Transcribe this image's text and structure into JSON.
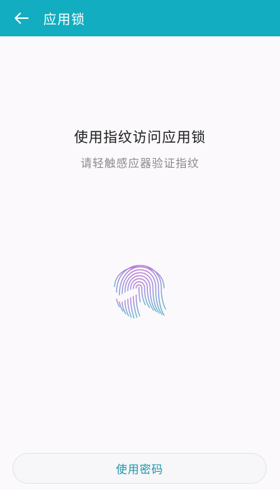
{
  "header": {
    "title": "应用锁",
    "background_color": "#12adc0"
  },
  "main": {
    "title": "使用指纹访问应用锁",
    "subtitle": "请轻触感应器验证指纹",
    "fingerprint_icon": "fingerprint-icon"
  },
  "footer": {
    "password_button_label": "使用密码",
    "accent_color": "#1799a9"
  }
}
